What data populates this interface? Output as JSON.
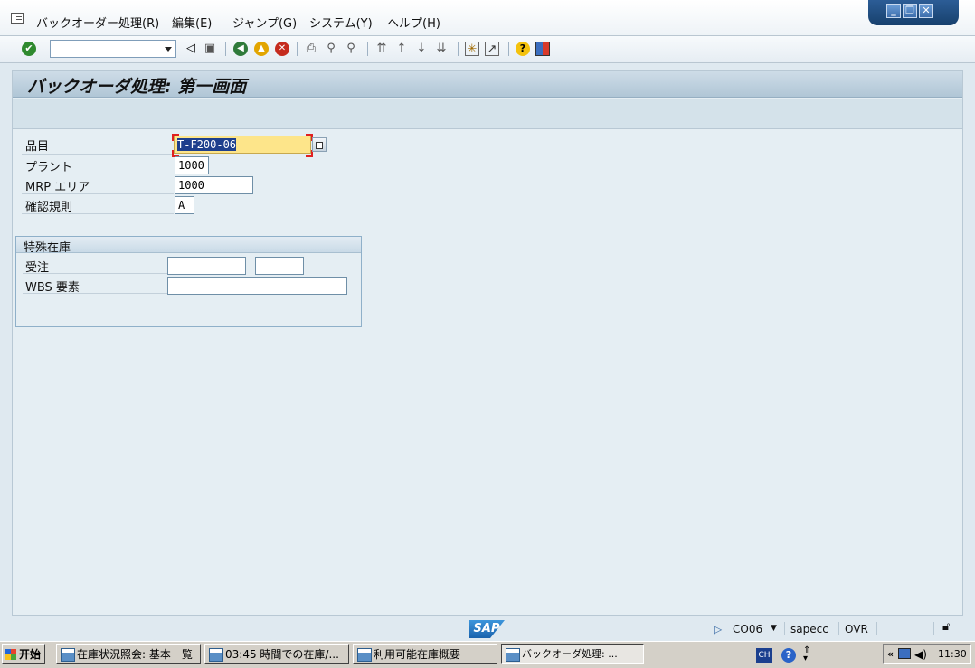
{
  "menu": {
    "items": [
      "バックオーダー処理(R)",
      "編集(E)",
      "ジャンプ(G)",
      "システム(Y)",
      "ヘルプ(H)"
    ]
  },
  "toolbar": {
    "command_value": "",
    "icons": [
      "enter-icon",
      "back-arrow-icon",
      "save-icon",
      "back-icon",
      "exit-icon",
      "cancel-icon",
      "print-icon",
      "find-icon",
      "find-next-icon",
      "first-page-icon",
      "previous-page-icon",
      "next-page-icon",
      "last-page-icon",
      "create-session-icon",
      "shortcut-icon",
      "help-icon",
      "layout-menu-icon"
    ]
  },
  "screen": {
    "title": "バックオーダ処理: 第一画面"
  },
  "form": {
    "material_label": "品目",
    "material_value": "T-F200-06",
    "plant_label": "プラント",
    "plant_value": "1000",
    "mrp_area_label": "MRP エリア",
    "mrp_area_value": "1000",
    "checking_rule_label": "確認規則",
    "checking_rule_value": "A"
  },
  "special_stock": {
    "title": "特殊在庫",
    "sales_order_label": "受注",
    "sales_order_value": "",
    "sales_order_item_value": "",
    "wbs_label": "WBS 要素",
    "wbs_value": ""
  },
  "status": {
    "transaction": "CO06",
    "server": "sapecc",
    "mode": "OVR",
    "logo": "SAP"
  },
  "taskbar": {
    "start": "开始",
    "tasks": [
      "在庫状況照会: 基本一覧",
      "03:45 時間での在庫/...",
      "利用可能在庫概要",
      "バックオーダ処理: ..."
    ],
    "lang": "CH",
    "clock": "11:30"
  },
  "colors": {
    "background": "#dfe9f0",
    "active_field": "#fde58a",
    "selection": "#1e3f8d"
  }
}
